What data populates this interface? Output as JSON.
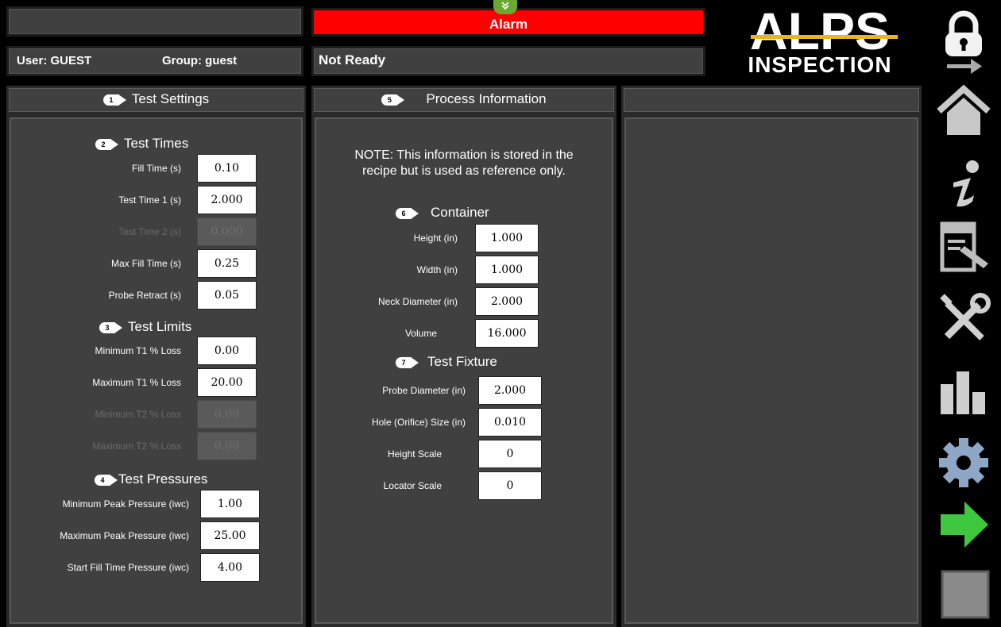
{
  "header": {
    "user_label": "User: GUEST",
    "group_label": "Group: guest",
    "alarm_label": "Alarm",
    "status_text": "Not Ready",
    "logo_top": "ALPS",
    "logo_bottom": "INSPECTION",
    "alarm_color": "#ff0000"
  },
  "panels": {
    "test_settings": {
      "badge": "1",
      "title": "Test Settings",
      "test_times": {
        "badge": "2",
        "title": "Test Times",
        "fields": [
          {
            "label": "Fill Time (s)",
            "value": "0.10",
            "enabled": true
          },
          {
            "label": "Test Time 1 (s)",
            "value": "2.000",
            "enabled": true
          },
          {
            "label": "Test Time 2 (s)",
            "value": "0.000",
            "enabled": false
          },
          {
            "label": "Max Fill Time (s)",
            "value": "0.25",
            "enabled": true
          },
          {
            "label": "Probe Retract (s)",
            "value": "0.05",
            "enabled": true
          }
        ]
      },
      "test_limits": {
        "badge": "3",
        "title": "Test Limits",
        "fields": [
          {
            "label": "Minimum T1 % Loss",
            "value": "0.00",
            "enabled": true
          },
          {
            "label": "Maximum T1 % Loss",
            "value": "20.00",
            "enabled": true
          },
          {
            "label": "Minimum T2 % Loss",
            "value": "0.00",
            "enabled": false
          },
          {
            "label": "Maximum T2 % Loss",
            "value": "0.00",
            "enabled": false
          }
        ]
      },
      "test_pressures": {
        "badge": "4",
        "title": "Test Pressures",
        "fields": [
          {
            "label": "Minimum Peak Pressure  (iwc)",
            "value": "1.00",
            "enabled": true
          },
          {
            "label": "Maximum Peak Pressure  (iwc)",
            "value": "25.00",
            "enabled": true
          },
          {
            "label": "Start Fill Time Pressure  (iwc)",
            "value": "4.00",
            "enabled": true
          }
        ]
      }
    },
    "process_information": {
      "badge": "5",
      "title": "Process Information",
      "note_line1": "NOTE:  This information is stored in the",
      "note_line2": "recipe but is used as reference only.",
      "container": {
        "badge": "6",
        "title": "Container",
        "fields": [
          {
            "label": "Height   (in)",
            "value": "1.000"
          },
          {
            "label": "Width   (in)",
            "value": "1.000"
          },
          {
            "label": "Neck Diameter   (in)",
            "value": "2.000"
          },
          {
            "label": "Volume",
            "value": "16.000"
          }
        ]
      },
      "test_fixture": {
        "badge": "7",
        "title": "Test Fixture",
        "fields": [
          {
            "label": "Probe Diameter   (in)",
            "value": "2.000"
          },
          {
            "label": "Hole (Orifice) Size   (in)",
            "value": "0.010"
          },
          {
            "label": "Height Scale",
            "value": "0"
          },
          {
            "label": "Locator Scale",
            "value": "0"
          }
        ]
      }
    },
    "third_panel": {
      "title": ""
    }
  },
  "sidebar": {
    "buttons": [
      {
        "icon": "logout-lock-icon"
      },
      {
        "icon": "home-icon"
      },
      {
        "icon": "info-icon"
      },
      {
        "icon": "recipe-edit-icon"
      },
      {
        "icon": "tools-icon"
      },
      {
        "icon": "statistics-icon"
      },
      {
        "icon": "settings-gear-icon"
      },
      {
        "icon": "start-arrow-icon"
      },
      {
        "icon": "stop-icon"
      }
    ]
  }
}
